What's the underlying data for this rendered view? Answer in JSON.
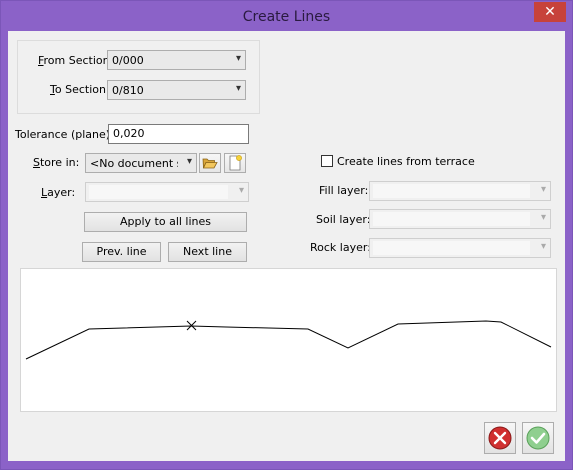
{
  "window": {
    "title": "Create Lines",
    "close_glyph": "✕"
  },
  "section": {
    "from_label": "From Section:",
    "from_value": "0/000",
    "to_label": "To Section:",
    "to_value": "0/810"
  },
  "tolerance": {
    "label": "Tolerance (plane):",
    "value": "0,020"
  },
  "store": {
    "label": "Store in:",
    "value": "<No document sele"
  },
  "layer": {
    "label": "Layer:",
    "value": ""
  },
  "buttons": {
    "apply_all": "Apply to all lines",
    "prev_line": "Prev. line",
    "next_line": "Next line"
  },
  "terrace": {
    "checkbox_label": "Create lines from terrace",
    "checked": false,
    "fill_label": "Fill layer:",
    "soil_label": "Soil layer:",
    "rock_label": "Rock layer:"
  },
  "icons": {
    "open_folder": "folder-open-icon",
    "new_doc": "new-document-icon",
    "cancel": "cancel-icon",
    "ok": "ok-icon"
  },
  "colors": {
    "title_bar": "#8b62c8",
    "close_button": "#c7423b",
    "cancel_icon": "#d03030",
    "ok_icon": "#8fcf8f"
  }
}
